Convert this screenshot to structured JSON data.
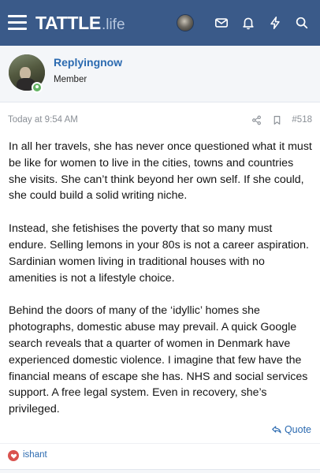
{
  "header": {
    "logo_main": "TATTLE",
    "logo_sub": ".life",
    "colors": {
      "bar": "#3a5a89",
      "logo_sub": "#b6c6de"
    },
    "icons": [
      "menu-icon",
      "user-avatar",
      "envelope-icon",
      "bell-icon",
      "lightning-icon",
      "search-icon"
    ]
  },
  "author": {
    "name": "Replyingnow",
    "title": "Member",
    "online": true
  },
  "post": {
    "date": "Today at 9:54 AM",
    "number": "#518",
    "paragraphs": [
      "In all her travels, she has never once questioned what it must be like for women to live in the cities, towns and countries she visits. She can’t think beyond her own self. If she could, she could build a solid writing niche.",
      "Instead, she fetishises the poverty that so many must endure. Selling lemons in your 80s is not a career aspiration. Sardinian women living in traditional houses with no amenities is not a lifestyle choice.",
      "Behind the doors of many of the ‘idyllic’ homes she photographs, domestic abuse may prevail. A quick Google search reveals that a quarter of women in Denmark have experienced domestic violence. I imagine that few have the financial means of escape she has. NHS and social services support. A free legal system. Even in recovery, she’s privileged."
    ],
    "quote_label": "Quote",
    "reaction_user": "ishant",
    "colors": {
      "link": "#2b6ab0",
      "reaction": "#d9534f"
    }
  }
}
